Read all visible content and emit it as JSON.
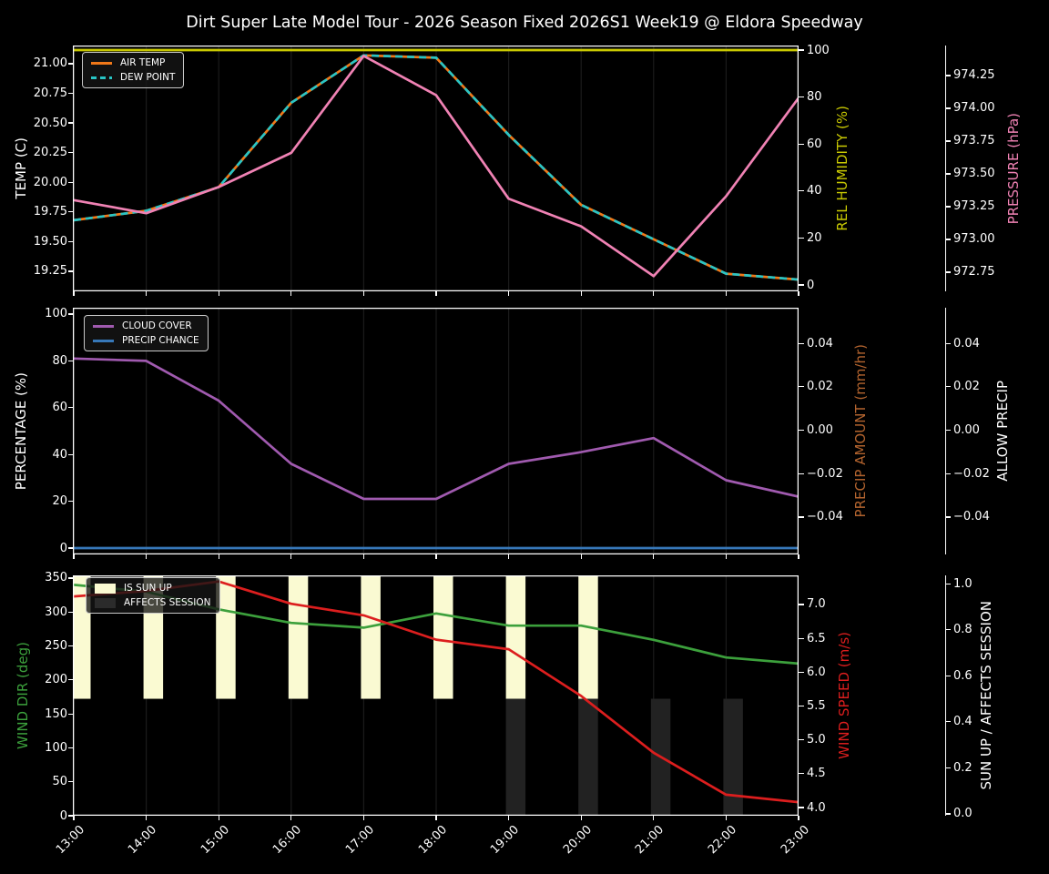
{
  "title": "Dirt Super Late Model Tour - 2026 Season Fixed 2026S1 Week19 @ Eldora Speedway",
  "x_axis": {
    "categories": [
      "13:00",
      "14:00",
      "15:00",
      "16:00",
      "17:00",
      "18:00",
      "19:00",
      "20:00",
      "21:00",
      "22:00",
      "23:00"
    ]
  },
  "panels": [
    {
      "left_axis": {
        "label": "TEMP (C)",
        "color": "#ffffff",
        "axis": "temp",
        "tick_values": [
          19.25,
          19.5,
          19.75,
          20.0,
          20.25,
          20.5,
          20.75,
          21.0
        ],
        "tick_labels": [
          "19.25",
          "19.50",
          "19.75",
          "20.00",
          "20.25",
          "20.50",
          "20.75",
          "21.00"
        ]
      },
      "right_axes": [
        {
          "label": "REL HUMIDITY (%)",
          "color": "#c9c902",
          "axis": "humidity",
          "tick_values": [
            0,
            20,
            40,
            60,
            80,
            100
          ],
          "tick_labels": [
            "0",
            "20",
            "40",
            "60",
            "80",
            "100"
          ]
        },
        {
          "label": "PRESSURE (hPa)",
          "color": "#f082b4",
          "axis": "pressure",
          "tick_values": [
            972.75,
            973.0,
            973.25,
            973.5,
            973.75,
            974.0,
            974.25
          ],
          "tick_labels": [
            "972.75",
            "973.00",
            "973.25",
            "973.50",
            "973.75",
            "974.00",
            "974.25"
          ]
        }
      ],
      "legend": [
        {
          "label": "AIR TEMP",
          "color": "#f07819",
          "swatch": "line"
        },
        {
          "label": "DEW POINT",
          "color": "#28c5c5",
          "swatch": "dash"
        }
      ]
    },
    {
      "left_axis": {
        "label": "PERCENTAGE (%)",
        "color": "#ffffff",
        "axis": "pct",
        "tick_values": [
          0,
          20,
          40,
          60,
          80,
          100
        ],
        "tick_labels": [
          "0",
          "20",
          "40",
          "60",
          "80",
          "100"
        ]
      },
      "right_axes": [
        {
          "label": "PRECIP AMOUNT (mm/hr)",
          "color": "#b2632e",
          "axis": "precip",
          "tick_values": [
            0.04,
            0.02,
            0.0,
            -0.02,
            -0.04
          ],
          "tick_labels": [
            "0.04",
            "0.02",
            "0.00",
            "−0.02",
            "−0.04"
          ]
        },
        {
          "label": "ALLOW PRECIP",
          "color": "#ffffff",
          "axis": "allow",
          "tick_values": [
            0.04,
            0.02,
            0.0,
            -0.02,
            -0.04
          ],
          "tick_labels": [
            "0.04",
            "0.02",
            "0.00",
            "−0.02",
            "−0.04"
          ]
        }
      ],
      "legend": [
        {
          "label": "CLOUD COVER",
          "color": "#a05aaf",
          "swatch": "line"
        },
        {
          "label": "PRECIP CHANCE",
          "color": "#3778b9",
          "swatch": "line"
        }
      ]
    },
    {
      "left_axis": {
        "label": "WIND DIR (deg)",
        "color": "#3ca03c",
        "axis": "deg",
        "tick_values": [
          0,
          50,
          100,
          150,
          200,
          250,
          300,
          350
        ],
        "tick_labels": [
          "0",
          "50",
          "100",
          "150",
          "200",
          "250",
          "300",
          "350"
        ]
      },
      "right_axes": [
        {
          "label": "WIND SPEED (m/s)",
          "color": "#dc1e1e",
          "axis": "speed",
          "tick_values": [
            4.0,
            4.5,
            5.0,
            5.5,
            6.0,
            6.5,
            7.0
          ],
          "tick_labels": [
            "4.0",
            "4.5",
            "5.0",
            "5.5",
            "6.0",
            "6.5",
            "7.0"
          ]
        },
        {
          "label": "SUN UP / AFFECTS SESSION",
          "color": "#ffffff",
          "axis": "sun",
          "tick_values": [
            0.0,
            0.2,
            0.4,
            0.6,
            0.8,
            1.0
          ],
          "tick_labels": [
            "0.0",
            "0.2",
            "0.4",
            "0.6",
            "0.8",
            "1.0"
          ]
        }
      ],
      "legend": [
        {
          "label": "IS SUN UP",
          "color": "#fafad2",
          "swatch": "patch"
        },
        {
          "label": "AFFECTS SESSION",
          "color": "#2b2b2b",
          "swatch": "patch"
        }
      ]
    }
  ],
  "chart_data": [
    {
      "type": "line",
      "x": [
        "13:00",
        "14:00",
        "15:00",
        "16:00",
        "17:00",
        "18:00",
        "19:00",
        "20:00",
        "21:00",
        "22:00",
        "23:00"
      ],
      "series": [
        {
          "name": "REL HUMIDITY",
          "axis": "humidity",
          "color": "#c9c902",
          "values": [
            100,
            100,
            100,
            100,
            100,
            100,
            100,
            100,
            100,
            100,
            100
          ]
        },
        {
          "name": "AIR TEMP",
          "axis": "temp",
          "color": "#f07819",
          "values": [
            19.68,
            19.76,
            19.96,
            20.67,
            21.07,
            21.05,
            20.4,
            19.81,
            19.52,
            19.23,
            19.18
          ]
        },
        {
          "name": "DEW POINT",
          "axis": "temp",
          "color": "#28c5c5",
          "dash": "8 5",
          "values": [
            19.68,
            19.76,
            19.96,
            20.67,
            21.07,
            21.05,
            20.4,
            19.81,
            19.52,
            19.23,
            19.18
          ]
        },
        {
          "name": "PRESSURE",
          "axis": "pressure",
          "color": "#f082b4",
          "values": [
            973.3,
            973.2,
            973.4,
            973.66,
            974.4,
            974.1,
            973.31,
            973.1,
            972.72,
            973.33,
            974.08
          ]
        }
      ],
      "axes": {
        "temp": {
          "ylim": [
            19.081,
            21.153
          ]
        },
        "humidity": {
          "ylim": [
            -2.71,
            101.94
          ]
        },
        "pressure": {
          "ylim": [
            972.604,
            974.479
          ]
        }
      }
    },
    {
      "type": "line",
      "x": [
        "13:00",
        "14:00",
        "15:00",
        "16:00",
        "17:00",
        "18:00",
        "19:00",
        "20:00",
        "21:00",
        "22:00",
        "23:00"
      ],
      "series": [
        {
          "name": "CLOUD COVER",
          "axis": "pct",
          "color": "#a05aaf",
          "values": [
            81,
            80,
            63,
            36,
            21,
            21,
            36,
            41,
            47,
            29,
            22
          ]
        },
        {
          "name": "PRECIP CHANCE",
          "axis": "pct",
          "color": "#3778b9",
          "values": [
            0,
            0,
            0,
            0,
            0,
            0,
            0,
            0,
            0,
            0,
            0
          ]
        }
      ],
      "axes": {
        "pct": {
          "ylim": [
            -2.72,
            102.7
          ]
        },
        "precip": {
          "ylim": [
            -0.0572,
            0.0564
          ]
        },
        "allow": {
          "ylim": [
            -0.0572,
            0.0564
          ]
        }
      }
    },
    {
      "type": "line+bar",
      "x": [
        "13:00",
        "14:00",
        "15:00",
        "16:00",
        "17:00",
        "18:00",
        "19:00",
        "20:00",
        "21:00",
        "22:00",
        "23:00"
      ],
      "bars": [
        {
          "name": "IS SUN UP",
          "color": "#fafad2",
          "axis": "sun",
          "half": "upper",
          "boundary": 0.5,
          "values": [
            1,
            1,
            1,
            1,
            1,
            1,
            1,
            1,
            0,
            0,
            0
          ]
        },
        {
          "name": "AFFECTS SESSION",
          "color": "#222222",
          "axis": "sun",
          "half": "lower",
          "boundary": 0.5,
          "values": [
            0,
            0,
            0,
            0,
            0,
            0,
            1,
            1,
            1,
            1,
            0
          ]
        }
      ],
      "series": [
        {
          "name": "WIND DIR",
          "axis": "deg",
          "color": "#3ca03c",
          "values": [
            340,
            330,
            304,
            284,
            277,
            298,
            280,
            280,
            259,
            233,
            224
          ]
        },
        {
          "name": "WIND SPEED",
          "axis": "speed",
          "color": "#dc1e1e",
          "values": [
            7.12,
            7.2,
            7.34,
            7.01,
            6.84,
            6.48,
            6.34,
            5.65,
            4.81,
            4.19,
            4.08
          ]
        }
      ],
      "axes": {
        "deg": {
          "ylim": [
            0,
            354
          ]
        },
        "speed": {
          "ylim": [
            3.88,
            7.43
          ]
        },
        "sun": {
          "ylim": [
            -0.008,
            1.036
          ]
        }
      }
    }
  ]
}
